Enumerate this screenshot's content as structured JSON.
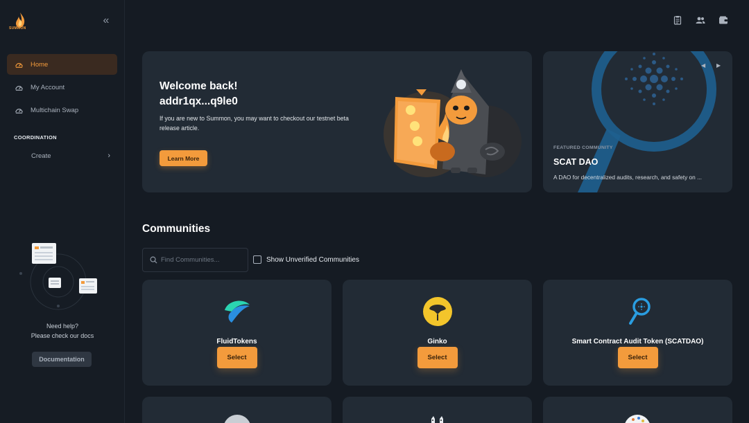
{
  "brand": {
    "name": "SUMMON",
    "accent": "#f39b3c"
  },
  "sidebar": {
    "items": [
      {
        "label": "Home",
        "active": true,
        "icon": "gauge-icon"
      },
      {
        "label": "My Account",
        "active": false,
        "icon": "gauge-icon"
      },
      {
        "label": "Multichain Swap",
        "active": false,
        "icon": "gauge-icon"
      }
    ],
    "section_label": "COORDINATION",
    "create_label": "Create",
    "help_line1": "Need help?",
    "help_line2": "Please check our docs",
    "docs_button": "Documentation"
  },
  "topbar": {
    "icons": [
      "clipboard-icon",
      "users-icon",
      "wallet-icon"
    ]
  },
  "welcome": {
    "title": "Welcome back!",
    "address": "addr1qx...q9le0",
    "message": "If you are new to Summon, you may want to checkout our testnet beta release article.",
    "button": "Learn More"
  },
  "featured": {
    "label": "FEATURED COMMUNITY",
    "name": "SCAT DAO",
    "description": "A DAO for decentralized audits, research, and safety on ..."
  },
  "communities": {
    "title": "Communities",
    "search_placeholder": "Find Communities...",
    "search_value": "",
    "checkbox_label": "Show Unverified Communities",
    "select_label": "Select",
    "cards": [
      {
        "name": "FluidTokens",
        "icon": "fluidtokens-logo"
      },
      {
        "name": "Ginko",
        "icon": "ginko-leaf-logo"
      },
      {
        "name": "Smart Contract Audit Token (SCATDAO)",
        "icon": "magnifier-logo"
      }
    ]
  }
}
